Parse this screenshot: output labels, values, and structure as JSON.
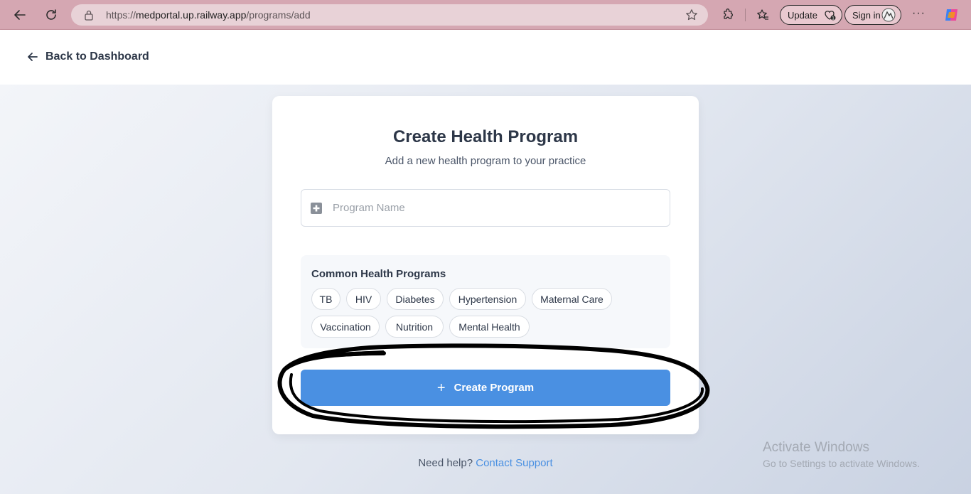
{
  "browser": {
    "url_prefix": "https://",
    "url_host": "medportal.up.railway.app",
    "url_path": "/programs/add",
    "update_label": "Update",
    "signin_label": "Sign in",
    "more_label": "···"
  },
  "header": {
    "back_label": "Back to Dashboard"
  },
  "form": {
    "title": "Create Health Program",
    "subtitle": "Add a new health program to your practice",
    "name_placeholder": "Program Name",
    "suggestions_title": "Common Health Programs",
    "suggestions": [
      "TB",
      "HIV",
      "Diabetes",
      "Hypertension",
      "Maternal Care",
      "Vaccination",
      "Nutrition",
      "Mental Health"
    ],
    "submit_icon": "+",
    "submit_label": "Create Program"
  },
  "footer": {
    "help_text": "Need help?",
    "help_link": "Contact Support"
  },
  "watermark": {
    "line1": "Activate Windows",
    "line2": "Go to Settings to activate Windows."
  },
  "colors": {
    "browser_bar": "#d5a7b2",
    "primary": "#4a90e2",
    "text_dark": "#2d3748"
  }
}
